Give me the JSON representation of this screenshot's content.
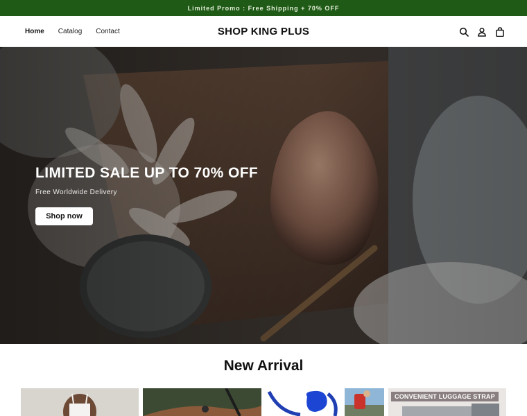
{
  "promo": {
    "text": "Limited Promo : Free Shipping + 70% OFF"
  },
  "header": {
    "logo": "SHOP KING PLUS",
    "nav": [
      {
        "label": "Home",
        "active": true
      },
      {
        "label": "Catalog",
        "active": false
      },
      {
        "label": "Contact",
        "active": false
      }
    ],
    "icons": [
      "search-icon",
      "account-icon",
      "cart-icon"
    ]
  },
  "hero": {
    "title": "LIMITED SALE UP TO 70% OFF",
    "subtitle": "Free Worldwide Delivery",
    "button_label": "Shop now"
  },
  "new_arrival": {
    "title": "New Arrival",
    "products": [
      {
        "image": "woman in white top"
      },
      {
        "image": "outdoor path with dog leash"
      },
      {
        "image": "blue retractable dog leash"
      },
      {
        "image": "traveler with backpack"
      },
      {
        "image": "luggage strap",
        "label": "CONVENIENT LUGGAGE STRAP"
      }
    ]
  },
  "colors": {
    "promo_bg": "#1f5a17",
    "promo_text": "#e6efd9",
    "hero_overlay": "#000000"
  }
}
